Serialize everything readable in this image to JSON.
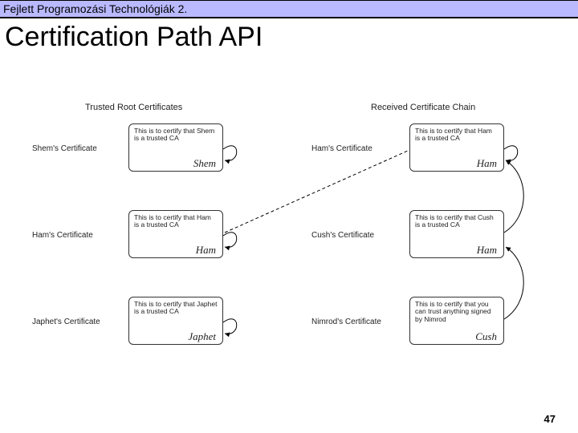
{
  "header": {
    "course": "Fejlett Programozási Technológiák 2."
  },
  "title": "Certification Path API",
  "columns": {
    "left": "Trusted Root Certificates",
    "right": "Received Certificate Chain"
  },
  "left_labels": {
    "row1": "Shem's Certificate",
    "row2": "Ham's Certificate",
    "row3": "Japhet's Certificate"
  },
  "right_labels": {
    "row1": "Ham's Certificate",
    "row2": "Cush's Certificate",
    "row3": "Nimrod's Certificate"
  },
  "certs": {
    "l1": {
      "text": "This is to certify that Shem is a trusted CA",
      "sig": "Shem"
    },
    "l2": {
      "text": "This is to certify that Ham is a trusted CA",
      "sig": "Ham"
    },
    "l3": {
      "text": "This is to certify that Japhet is a trusted CA",
      "sig": "Japhet"
    },
    "r1": {
      "text": "This is to certify that Ham is a trusted CA",
      "sig": "Ham"
    },
    "r2": {
      "text": "This is to certify that Cush is a trusted CA",
      "sig": "Ham"
    },
    "r3": {
      "text": "This is to certify that you can trust anything signed by Nimrod",
      "sig": "Cush"
    }
  },
  "slide_number": "47"
}
